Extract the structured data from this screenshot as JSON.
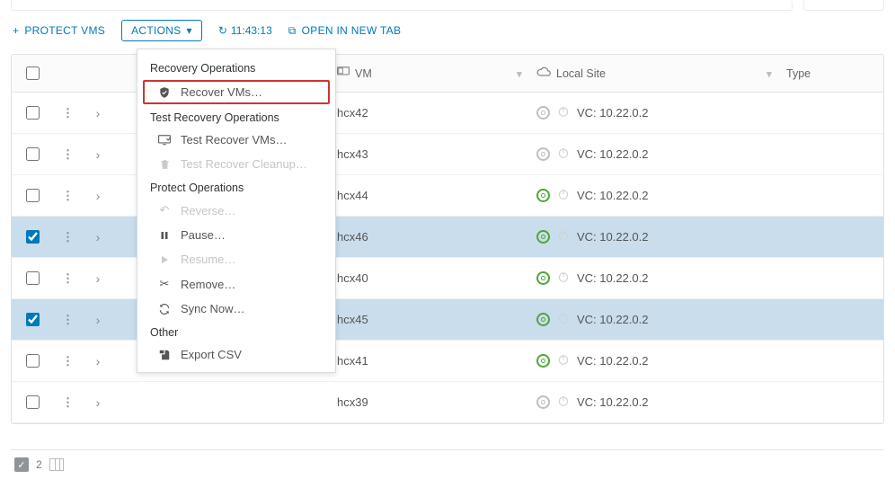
{
  "toolbar": {
    "protect_label": "PROTECT VMS",
    "actions_label": "ACTIONS",
    "time": "11:43:13",
    "open_tab_label": "OPEN IN NEW TAB"
  },
  "columns": {
    "vm": "VM",
    "local": "Local Site",
    "type": "Type"
  },
  "rows": [
    {
      "vm": "hcx42",
      "vc": "VC: 10.22.0.2",
      "status": "grey",
      "checked": false,
      "selected": false
    },
    {
      "vm": "hcx43",
      "vc": "VC: 10.22.0.2",
      "status": "grey",
      "checked": false,
      "selected": false
    },
    {
      "vm": "hcx44",
      "vc": "VC: 10.22.0.2",
      "status": "green",
      "checked": false,
      "selected": false
    },
    {
      "vm": "hcx46",
      "vc": "VC: 10.22.0.2",
      "status": "green",
      "checked": true,
      "selected": true
    },
    {
      "vm": "hcx40",
      "vc": "VC: 10.22.0.2",
      "status": "green",
      "checked": false,
      "selected": false
    },
    {
      "vm": "hcx45",
      "vc": "VC: 10.22.0.2",
      "status": "green",
      "checked": true,
      "selected": true
    },
    {
      "vm": "hcx41",
      "vc": "VC: 10.22.0.2",
      "status": "green",
      "checked": false,
      "selected": false
    },
    {
      "vm": "hcx39",
      "vc": "VC: 10.22.0.2",
      "status": "grey",
      "checked": false,
      "selected": false
    }
  ],
  "dropdown": {
    "section_recovery": "Recovery Operations",
    "recover": "Recover VMs…",
    "section_test": "Test Recovery Operations",
    "test_recover": "Test Recover VMs…",
    "test_cleanup": "Test Recover Cleanup…",
    "section_protect": "Protect Operations",
    "reverse": "Reverse…",
    "pause": "Pause…",
    "resume": "Resume…",
    "remove": "Remove…",
    "sync": "Sync Now…",
    "section_other": "Other",
    "export": "Export CSV"
  },
  "footer": {
    "selected_count": "2"
  }
}
